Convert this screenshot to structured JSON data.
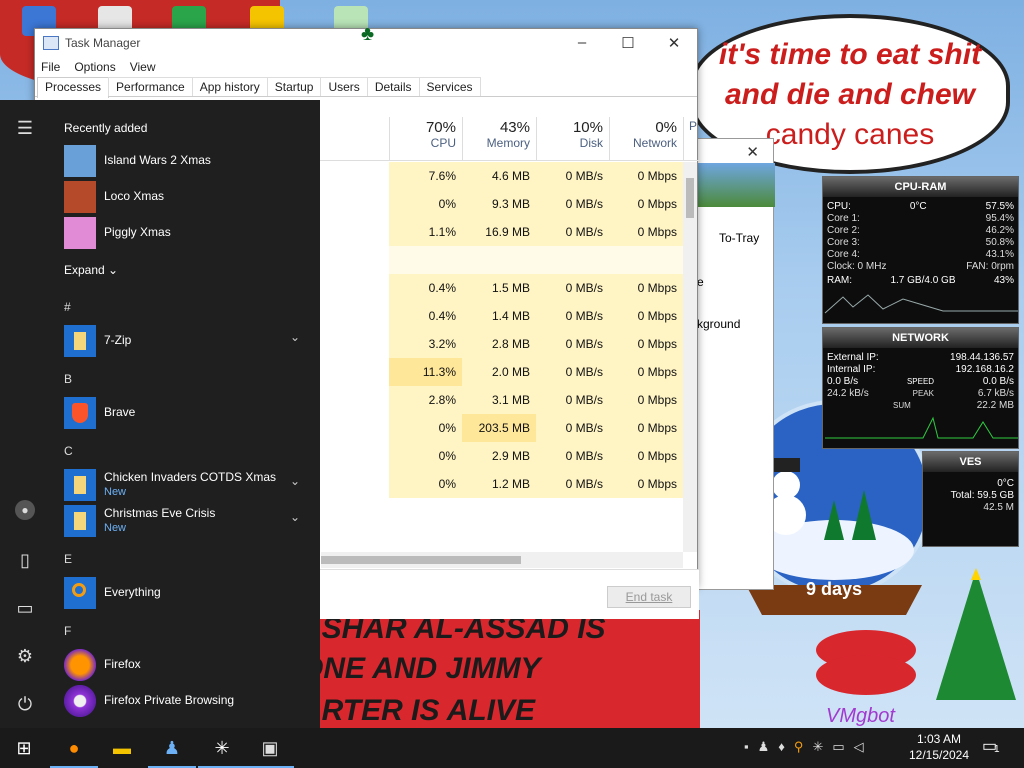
{
  "wallpaper": {
    "bubble_lines": [
      "it's time to eat shit",
      "and die and chew",
      "candy canes"
    ],
    "red_lines": [
      "ASHAR AL-ASSAD IS",
      "ONE AND JIMMY",
      "ARTER IS ALIVE"
    ],
    "countdown": "9 days",
    "watermark": "VMgbot"
  },
  "task_manager": {
    "title": "Task Manager",
    "menu": [
      "File",
      "Options",
      "View"
    ],
    "tabs": [
      "Processes",
      "Performance",
      "App history",
      "Startup",
      "Users",
      "Details",
      "Services"
    ],
    "active_tab": "Processes",
    "columns": [
      {
        "pct": "70%",
        "label": "CPU"
      },
      {
        "pct": "43%",
        "label": "Memory"
      },
      {
        "pct": "10%",
        "label": "Disk"
      },
      {
        "pct": "0%",
        "label": "Network"
      },
      {
        "pct": "",
        "label": "P"
      }
    ],
    "rows": [
      {
        "cpu": "7.6%",
        "mem": "4.6 MB",
        "disk": "0 MB/s",
        "net": "0 Mbps"
      },
      {
        "cpu": "0%",
        "mem": "9.3 MB",
        "disk": "0 MB/s",
        "net": "0 Mbps"
      },
      {
        "cpu": "1.1%",
        "mem": "16.9 MB",
        "disk": "0 MB/s",
        "net": "0 Mbps"
      },
      {
        "cpu": "",
        "mem": "",
        "disk": "",
        "net": ""
      },
      {
        "cpu": "0.4%",
        "mem": "1.5 MB",
        "disk": "0 MB/s",
        "net": "0 Mbps"
      },
      {
        "cpu": "0.4%",
        "mem": "1.4 MB",
        "disk": "0 MB/s",
        "net": "0 Mbps"
      },
      {
        "cpu": "3.2%",
        "mem": "2.8 MB",
        "disk": "0 MB/s",
        "net": "0 Mbps"
      },
      {
        "cpu": "11.3%",
        "mem": "2.0 MB",
        "disk": "0 MB/s",
        "net": "0 Mbps"
      },
      {
        "cpu": "2.8%",
        "mem": "3.1 MB",
        "disk": "0 MB/s",
        "net": "0 Mbps"
      },
      {
        "cpu": "0%",
        "mem": "203.5 MB",
        "disk": "0 MB/s",
        "net": "0 Mbps"
      },
      {
        "cpu": "0%",
        "mem": "2.9 MB",
        "disk": "0 MB/s",
        "net": "0 Mbps"
      },
      {
        "cpu": "0%",
        "mem": "1.2 MB",
        "disk": "0 MB/s",
        "net": "0 Mbps"
      }
    ],
    "end_task": "End task"
  },
  "back_window": {
    "to_tray": "To-Tray",
    "text1": "e",
    "text2": "kground"
  },
  "gadget_cpu": {
    "title": "CPU-RAM",
    "cpu_label": "CPU:",
    "cpu_temp": "0°C",
    "cpu_pct": "57.5%",
    "cores": [
      {
        "label": "Core 1:",
        "pct": "95.4%"
      },
      {
        "label": "Core 2:",
        "pct": "46.2%"
      },
      {
        "label": "Core 3:",
        "pct": "50.8%"
      },
      {
        "label": "Core 4:",
        "pct": "43.1%"
      }
    ],
    "clock": "Clock: 0 MHz",
    "fan": "FAN: 0rpm",
    "ram_label": "RAM:",
    "ram_value": "1.7 GB/4.0 GB",
    "ram_pct": "43%"
  },
  "gadget_net": {
    "title": "NETWORK",
    "ext_label": "External IP:",
    "ext_ip": "198.44.136.57",
    "int_label": "Internal IP:",
    "int_ip": "192.168.16.2",
    "speed_left": "0.0 B/s",
    "speed_label": "SPEED",
    "speed_right": "0.0 B/s",
    "peak_left": "24.2 kB/s",
    "peak_label": "PEAK",
    "peak_right": "6.7 kB/s",
    "sum_left": "",
    "sum_label": "SUM",
    "sum_right": "22.2 MB"
  },
  "gadget_drives": {
    "title": "VES",
    "temp": "0°C",
    "total": "Total: 59.5 GB",
    "free": "42.5 M"
  },
  "start_menu": {
    "recently_added": "Recently added",
    "recent": [
      {
        "label": "Island Wars 2 Xmas",
        "icon": "island-wars-icon"
      },
      {
        "label": "Loco Xmas",
        "icon": "loco-icon"
      },
      {
        "label": "Piggly Xmas",
        "icon": "piggly-icon"
      }
    ],
    "expand": "Expand",
    "groups": {
      "hash": "#",
      "b": "B",
      "c": "C",
      "e": "E",
      "f": "F"
    },
    "apps": {
      "sevenzip": "7-Zip",
      "brave": "Brave",
      "chicken": "Chicken Invaders COTDS Xmas",
      "chicken_new": "New",
      "christmas": "Christmas Eve Crisis",
      "christmas_new": "New",
      "everything": "Everything",
      "firefox": "Firefox",
      "firefox_private": "Firefox Private Browsing"
    }
  },
  "taskbar": {
    "time": "1:03 AM",
    "date": "12/15/2024",
    "notification_count": "1"
  },
  "colors": {
    "start_bg": "#1f1f1f",
    "accent": "#6cb0f5",
    "cpu_heat": "#fff4c4",
    "cpu_heat_strong": "#ffe79a"
  }
}
